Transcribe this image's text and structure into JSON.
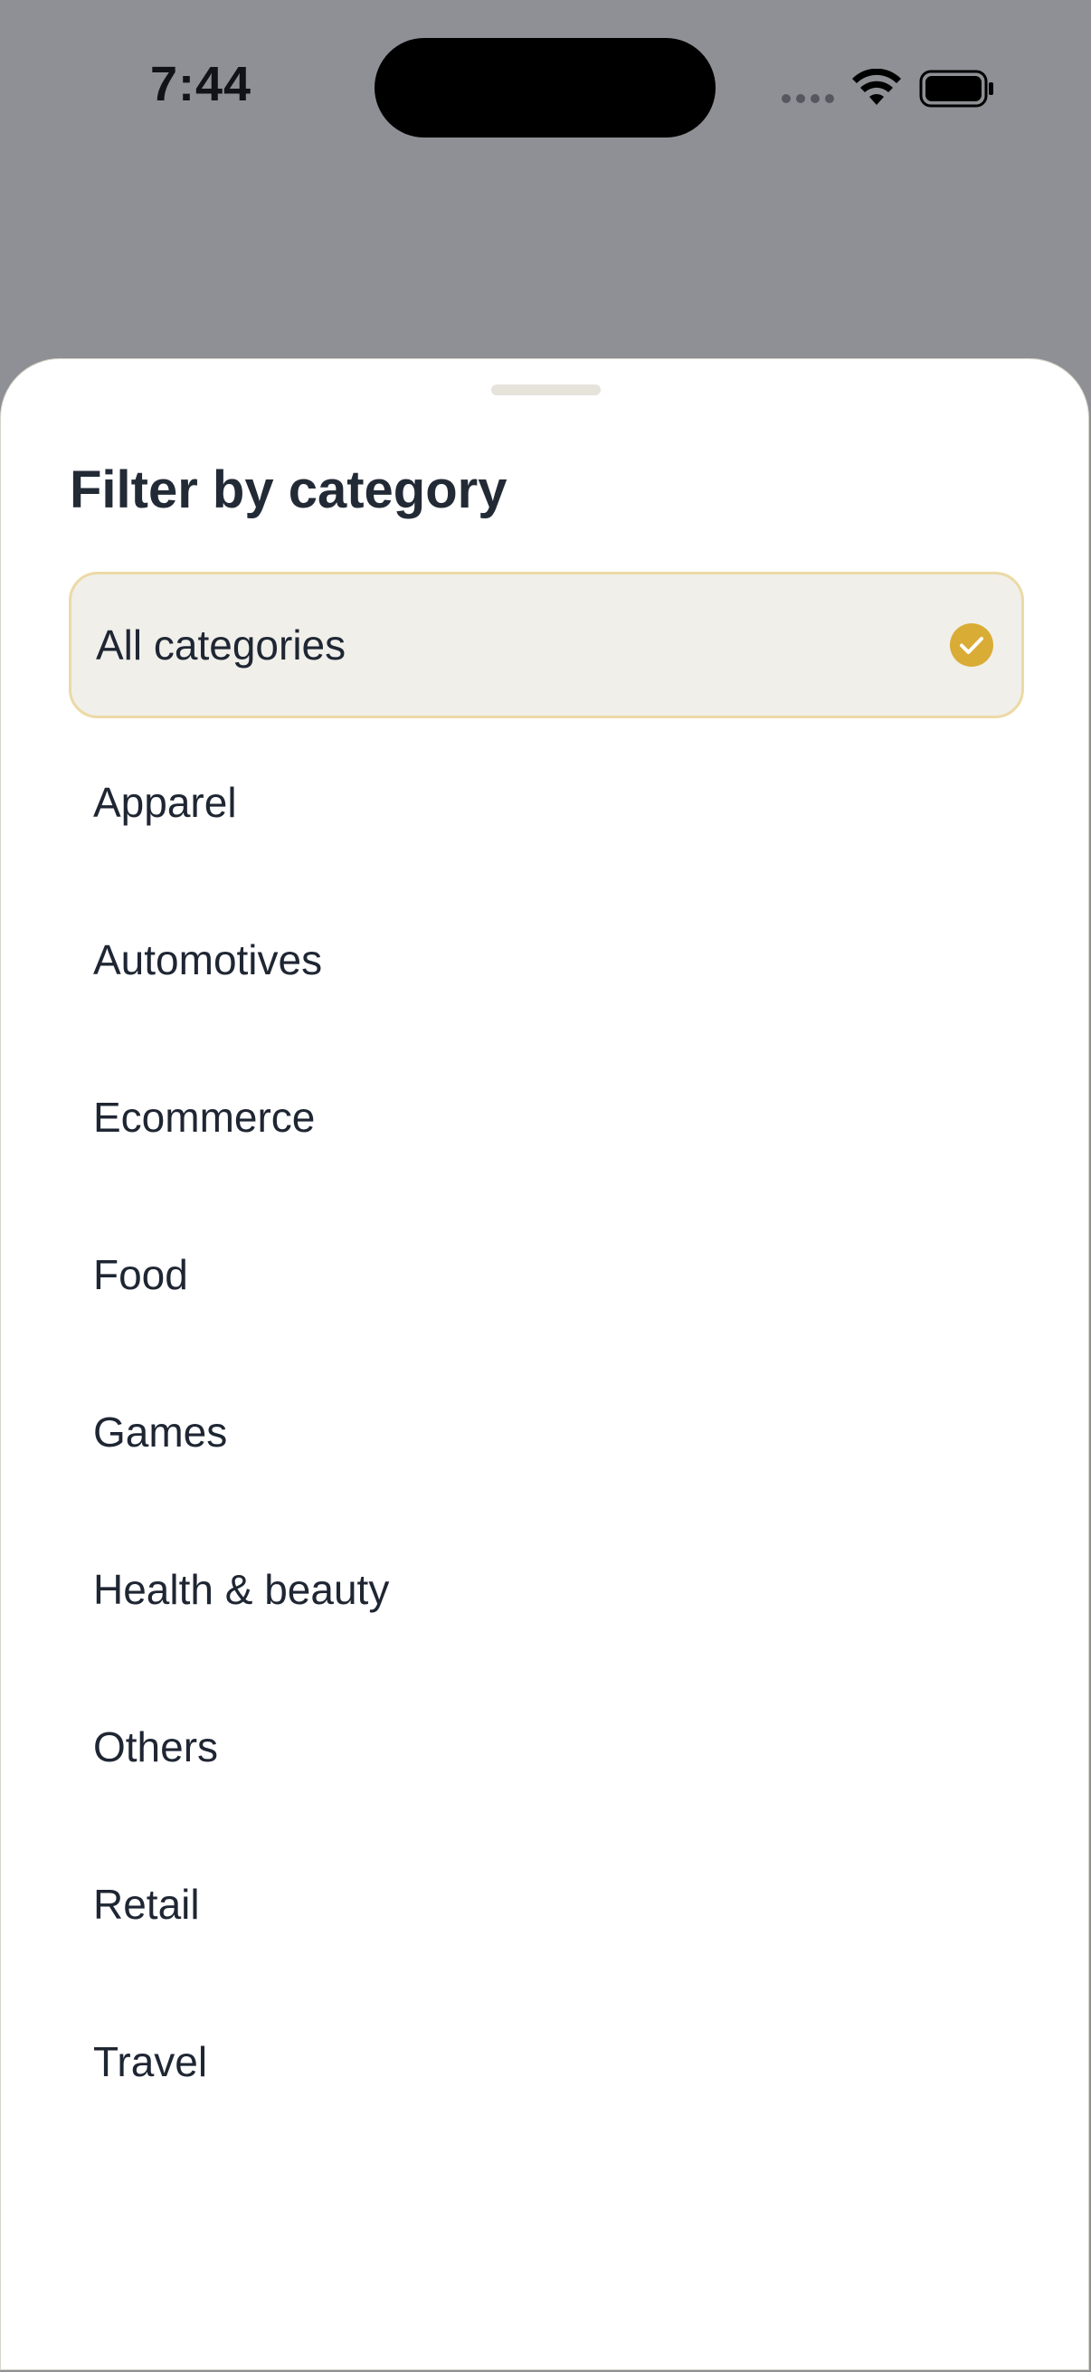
{
  "status_bar": {
    "time": "7:44"
  },
  "sheet": {
    "title": "Filter by category",
    "options": [
      {
        "label": "All categories",
        "selected": true
      },
      {
        "label": "Apparel",
        "selected": false
      },
      {
        "label": "Automotives",
        "selected": false
      },
      {
        "label": "Ecommerce",
        "selected": false
      },
      {
        "label": "Food",
        "selected": false
      },
      {
        "label": "Games",
        "selected": false
      },
      {
        "label": "Health & beauty",
        "selected": false
      },
      {
        "label": "Others",
        "selected": false
      },
      {
        "label": "Retail",
        "selected": false
      },
      {
        "label": "Travel",
        "selected": false
      }
    ]
  },
  "colors": {
    "backdrop": "#8e9095",
    "accent": "#d9ac35",
    "selected_bg": "#f0efea",
    "selected_border": "#ecd9a6",
    "text": "#1f2633"
  },
  "icons": {
    "selected_indicator": "check-circle-icon",
    "wifi": "wifi-icon",
    "battery": "battery-icon"
  }
}
